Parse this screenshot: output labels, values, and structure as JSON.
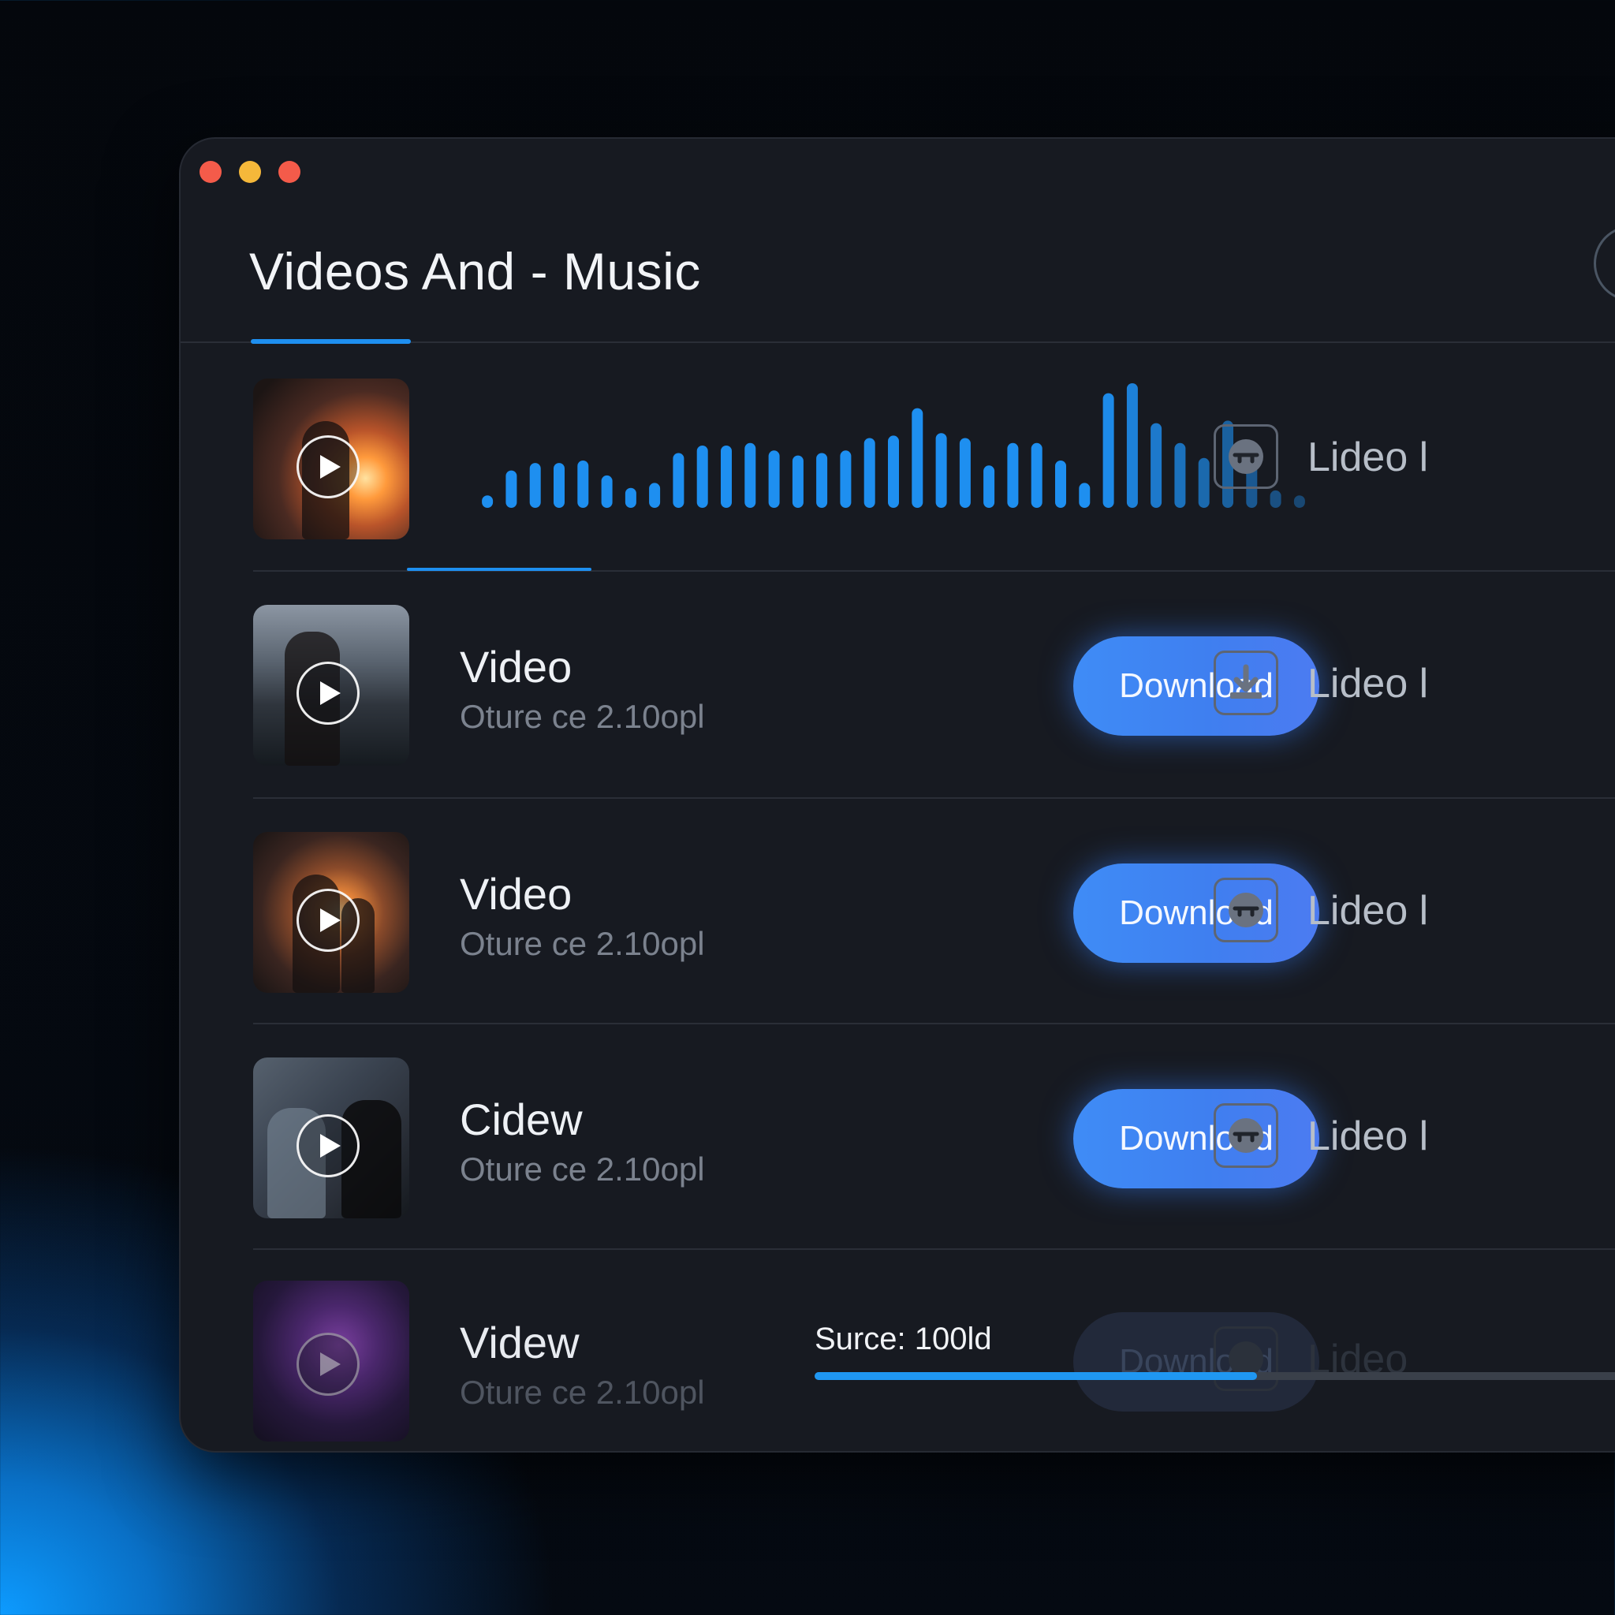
{
  "window": {
    "title": "Videos And - Music",
    "traffic_lights": [
      "#f45b4a",
      "#f5b83a",
      "#f45b4a"
    ]
  },
  "rows": [
    {
      "type": "waveform",
      "side_label": "Lideo l",
      "icon": "record-icon"
    },
    {
      "name": "Video",
      "meta": "Oture ce 2.10opl",
      "download_label": "Download",
      "side_label": "Lideo l",
      "icon": "download-arrow-icon"
    },
    {
      "name": "Video",
      "meta": "Oture ce 2.10opl",
      "download_label": "Download",
      "side_label": "Lideo l",
      "icon": "record-icon"
    },
    {
      "name": "Cidew",
      "meta": "Oture ce 2.10opl",
      "download_label": "Download",
      "side_label": "Lideo l",
      "icon": "record-icon"
    },
    {
      "name": "Videw",
      "meta": "Oture ce 2.10opl",
      "download_label": "Download",
      "side_label": "Lideo",
      "icon": "record-icon",
      "progress_label": "Surce: 100ld",
      "progress_fraction": 0.51
    }
  ],
  "colors": {
    "accent": "#1e8ff0",
    "button": "#3f85f4",
    "window_bg": "#171a21"
  },
  "waveform": [
    0.1,
    0.3,
    0.36,
    0.36,
    0.38,
    0.26,
    0.16,
    0.2,
    0.44,
    0.5,
    0.5,
    0.52,
    0.46,
    0.42,
    0.44,
    0.46,
    0.56,
    0.58,
    0.8,
    0.6,
    0.56,
    0.34,
    0.52,
    0.52,
    0.38,
    0.2,
    0.92,
    1.0,
    0.68,
    0.52,
    0.4,
    0.7,
    0.46,
    0.14,
    0.1
  ]
}
